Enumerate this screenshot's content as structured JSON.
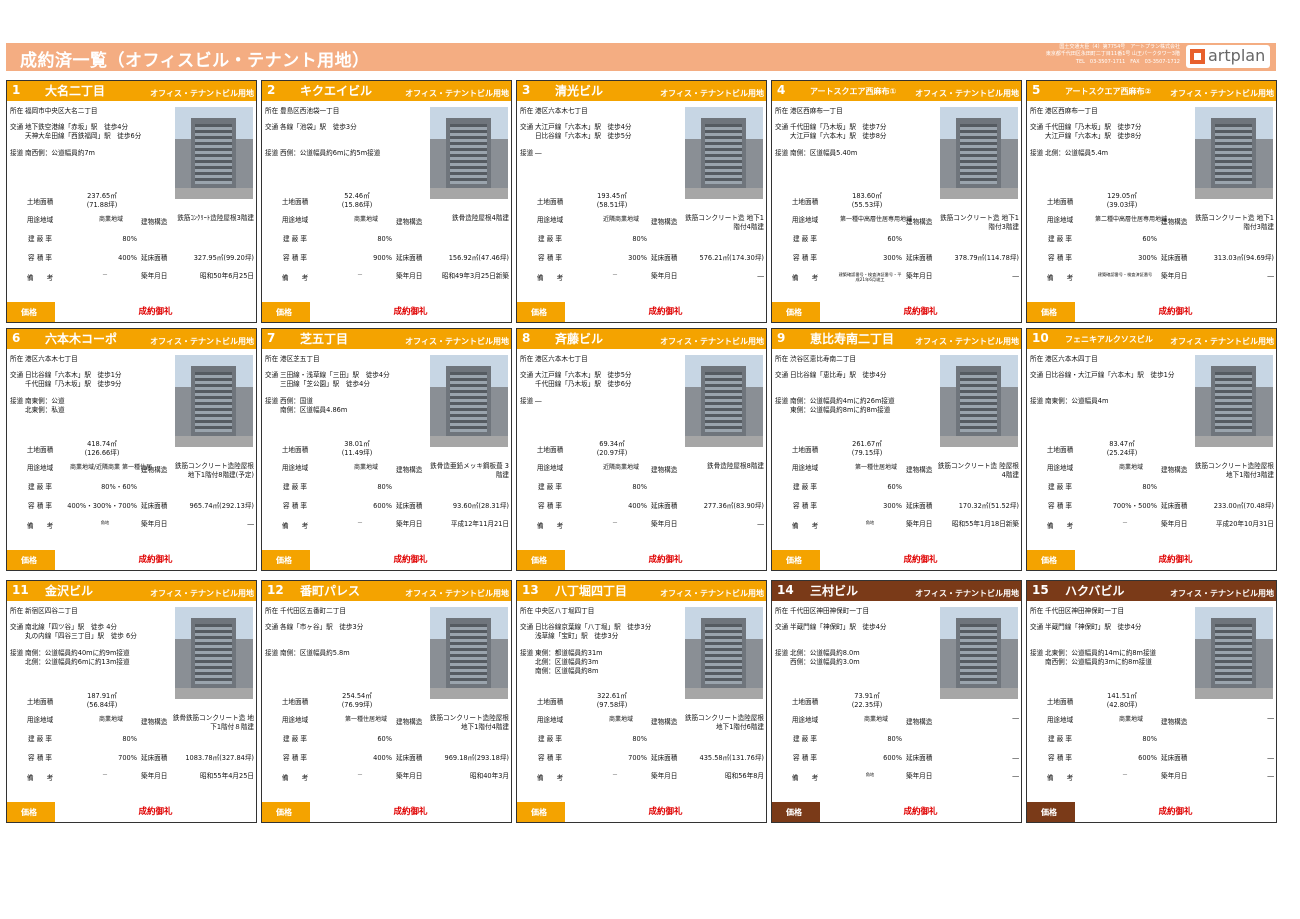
{
  "page": {
    "title": "成約済一覧（オフィスビル・テナント用地）",
    "company_lines": [
      "国土交通大臣（4）第7754号　アートプラン株式会社",
      "東京都千代田区永田町二丁目11番1号 山王パークタワー3階",
      "TEL　03-3507-1711　FAX　03-3507-1712"
    ],
    "logo_text": "artplan"
  },
  "labels": {
    "addr": "所在",
    "transit": "交通",
    "road": "接道",
    "land_area": "土地面積",
    "zoning": "用途地域",
    "coverage": "建 蔽 率",
    "far": "容 積 率",
    "remarks": "備　　考",
    "structure": "建物構造",
    "floor_area": "延床面積",
    "built": "築年月日",
    "price": "価格"
  },
  "properties": [
    {
      "num": "1",
      "name": "大名二丁目",
      "category": "オフィス・テナントビル用地",
      "address": "福岡市中央区大名二丁目",
      "transit": [
        "地下鉄空港線「赤坂」駅　徒歩4分",
        "天神大牟田線「西鉄福岡」駅　徒歩6分"
      ],
      "road": [
        "南西側：公道幅員約7m"
      ],
      "land_area": "237.65㎡",
      "land_tsubo": "(71.88坪)",
      "zoning": "商業地域",
      "coverage": "80%",
      "far": "400%",
      "remarks": "―",
      "structure": "鉄筋ｺﾝｸﾘｰﾄ造陸屋根3階建",
      "floor_area": "327.95㎡(99.20坪)",
      "built": "昭和50年6月25日",
      "price": "成約御礼"
    },
    {
      "num": "2",
      "name": "キクエイビル",
      "category": "オフィス・テナントビル用地",
      "address": "豊島区西池袋一丁目",
      "transit": [
        "各線「池袋」駅　徒歩3分"
      ],
      "road": [
        "西側：公道幅員約6mに約5m接道"
      ],
      "land_area": "52.46㎡",
      "land_tsubo": "(15.86坪)",
      "zoning": "商業地域",
      "coverage": "80%",
      "far": "900%",
      "remarks": "―",
      "structure": "鉄骨造陸屋根4階建",
      "floor_area": "156.92㎡(47.46坪)",
      "built": "昭和49年3月25日新築",
      "price": "成約御礼"
    },
    {
      "num": "3",
      "name": "清光ビル",
      "category": "オフィス・テナントビル用地",
      "address": "港区六本木七丁目",
      "transit": [
        "大江戸線「六本木」駅　徒歩4分",
        "日比谷線「六本木」駅　徒歩5分"
      ],
      "road": [
        "―"
      ],
      "land_area": "193.45㎡",
      "land_tsubo": "(58.51坪)",
      "zoning": "近隣商業地域",
      "coverage": "80%",
      "far": "300%",
      "remarks": "―",
      "structure": "鉄筋コンクリート造 地下1階付4階建",
      "floor_area": "576.21㎡(174.30坪)",
      "built": "―",
      "price": "成約御礼"
    },
    {
      "num": "4",
      "name": "アートスクエア西麻布①",
      "category": "オフィス・テナントビル用地",
      "address": "港区西麻布一丁目",
      "transit": [
        "千代田線「乃木坂」駅　徒歩7分",
        "大江戸線「六本木」駅　徒歩8分"
      ],
      "road": [
        "南側：区道幅員5.40m"
      ],
      "land_area": "183.60㎡",
      "land_tsubo": "(55.53坪)",
      "zoning": "第一種中高層住居専用地域",
      "coverage": "60%",
      "far": "300%",
      "remarks": "建築確認番号・検査済証番号・平成21年6月竣工",
      "structure": "鉄筋コンクリート造 地下1階付3階建",
      "floor_area": "378.79㎡(114.78坪)",
      "built": "―",
      "price": "成約御礼"
    },
    {
      "num": "5",
      "name": "アートスクエア西麻布②",
      "category": "オフィス・テナントビル用地",
      "address": "港区西麻布一丁目",
      "transit": [
        "千代田線「乃木坂」駅　徒歩7分",
        "大江戸線「六本木」駅　徒歩8分"
      ],
      "road": [
        "北側：公道幅員5.4m"
      ],
      "land_area": "129.05㎡",
      "land_tsubo": "(39.03坪)",
      "zoning": "第二種中高層住居専用地域",
      "coverage": "60%",
      "far": "300%",
      "remarks": "建築確認番号・検査済証番号",
      "structure": "鉄筋コンクリート造 地下1階付3階建",
      "floor_area": "313.03㎡(94.69坪)",
      "built": "―",
      "price": "成約御礼"
    },
    {
      "num": "6",
      "name": "六本木コーポ",
      "category": "オフィス・テナントビル用地",
      "address": "港区六本木七丁目",
      "transit": [
        "日比谷線「六本木」駅　徒歩1分",
        "千代田線「乃木坂」駅　徒歩9分"
      ],
      "road": [
        "南東側：公道",
        "北東側：私道"
      ],
      "land_area": "418.74㎡",
      "land_tsubo": "(126.66坪)",
      "zoning": "商業地域/近隣商業 第一種住居",
      "coverage": "80%・60%",
      "far": "400%・300%・700%",
      "remarks": "角地",
      "structure": "鉄筋コンクリート造陸屋根 地下1階付8階建(予定)",
      "floor_area": "965.74㎡(292.13坪)",
      "built": "―",
      "price": "成約御礼"
    },
    {
      "num": "7",
      "name": "芝五丁目",
      "category": "オフィス・テナントビル用地",
      "address": "港区芝五丁目",
      "transit": [
        "三田線・浅草線「三田」駅　徒歩4分",
        "三田線「芝公園」駅　徒歩4分"
      ],
      "road": [
        "西側：国道",
        "南側：区道幅員4.86m"
      ],
      "land_area": "38.01㎡",
      "land_tsubo": "(11.49坪)",
      "zoning": "商業地域",
      "coverage": "80%",
      "far": "600%",
      "remarks": "―",
      "structure": "鉄骨造亜鉛メッキ鋼板葺 3階建",
      "floor_area": "93.60㎡(28.31坪)",
      "built": "平成12年11月21日",
      "price": "成約御礼"
    },
    {
      "num": "8",
      "name": "斉藤ビル",
      "category": "オフィス・テナントビル用地",
      "address": "港区六本木七丁目",
      "transit": [
        "大江戸線「六本木」駅　徒歩5分",
        "千代田線「乃木坂」駅　徒歩6分"
      ],
      "road": [
        "―"
      ],
      "land_area": "69.34㎡",
      "land_tsubo": "(20.97坪)",
      "zoning": "近隣商業地域",
      "coverage": "80%",
      "far": "400%",
      "remarks": "―",
      "structure": "鉄骨造陸屋根8階建",
      "floor_area": "277.36㎡(83.90坪)",
      "built": "―",
      "price": "成約御礼"
    },
    {
      "num": "9",
      "name": "恵比寿南二丁目",
      "category": "オフィス・テナントビル用地",
      "address": "渋谷区恵比寿南二丁目",
      "transit": [
        "日比谷線「恵比寿」駅　徒歩4分"
      ],
      "road": [
        "南側：公道幅員約4mに約26m接道",
        "東側：公道幅員約8mに約8m接道"
      ],
      "land_area": "261.67㎡",
      "land_tsubo": "(79.15坪)",
      "zoning": "第一種住居地域",
      "coverage": "60%",
      "far": "300%",
      "remarks": "角地",
      "structure": "鉄筋コンクリート造 陸屋根4階建",
      "floor_area": "170.32㎡(51.52坪)",
      "built": "昭和55年1月18日新築",
      "price": "成約御礼"
    },
    {
      "num": "10",
      "name": "フェニキアルクソスビル",
      "category": "オフィス・テナントビル用地",
      "address": "港区六本木四丁目",
      "transit": [
        "日比谷線・大江戸線「六本木」駅　徒歩1分"
      ],
      "road": [
        "南東側：公道幅員4m"
      ],
      "land_area": "83.47㎡",
      "land_tsubo": "(25.24坪)",
      "zoning": "商業地域",
      "coverage": "80%",
      "far": "700%・500%",
      "remarks": "―",
      "structure": "鉄筋コンクリート造陸屋根 地下1階付3階建",
      "floor_area": "233.00㎡(70.48坪)",
      "built": "平成20年10月31日",
      "price": "成約御礼"
    },
    {
      "num": "11",
      "name": "金沢ビル",
      "category": "オフィス・テナントビル用地",
      "address": "新宿区四谷二丁目",
      "transit": [
        "南北線「四ツ谷」駅　徒歩 4分",
        "丸の内線「四谷三丁目」駅　徒歩 6分"
      ],
      "road": [
        "南側：公道幅員約40mに約9m接道",
        "北側：公道幅員約6mに約13m接道"
      ],
      "land_area": "187.91㎡",
      "land_tsubo": "(56.84坪)",
      "zoning": "商業地域",
      "coverage": "80%",
      "far": "700%",
      "remarks": "―",
      "structure": "鉄骨鉄筋コンクリート造 地下1階付８階建",
      "floor_area": "1083.78㎡(327.84坪)",
      "built": "昭和55年4月25日",
      "price": "成約御礼"
    },
    {
      "num": "12",
      "name": "番町パレス",
      "category": "オフィス・テナントビル用地",
      "address": "千代田区五番町二丁目",
      "transit": [
        "各線「市ヶ谷」駅　徒歩3分"
      ],
      "road": [
        "南側：区道幅員約5.8m"
      ],
      "land_area": "254.54㎡",
      "land_tsubo": "(76.99坪)",
      "zoning": "第一種住居地域",
      "coverage": "60%",
      "far": "400%",
      "remarks": "―",
      "structure": "鉄筋コンクリート造陸屋根 地下1階付4階建",
      "floor_area": "969.18㎡(293.18坪)",
      "built": "昭和40年3月",
      "price": "成約御礼"
    },
    {
      "num": "13",
      "name": "八丁堀四丁目",
      "category": "オフィス・テナントビル用地",
      "address": "中央区八丁堀四丁目",
      "transit": [
        "日比谷線京葉線「八丁堀」駅　徒歩3分",
        "浅草線「宝町」駅　徒歩3分"
      ],
      "road": [
        "東側：都道幅員約31m",
        "北側：区道幅員約3m",
        "南側：区道幅員約8m"
      ],
      "land_area": "322.61㎡",
      "land_tsubo": "(97.58坪)",
      "zoning": "商業地域",
      "coverage": "80%",
      "far": "700%",
      "remarks": "―",
      "structure": "鉄筋コンクリート造陸屋根 地下1階付6階建",
      "floor_area": "435.58㎡(131.76坪)",
      "built": "昭和56年8月",
      "price": "成約御礼"
    },
    {
      "num": "14",
      "name": "三村ビル",
      "category": "オフィス・テナントビル用地",
      "address": "千代田区神田神保町一丁目",
      "transit": [
        "半蔵門線「神保町」駅　徒歩4分"
      ],
      "road": [
        "北側：公道幅員約8.0m",
        "西側：公道幅員約3.0m"
      ],
      "land_area": "73.91㎡",
      "land_tsubo": "(22.35坪)",
      "zoning": "商業地域",
      "coverage": "80%",
      "far": "600%",
      "remarks": "角地",
      "structure": "―",
      "floor_area": "―",
      "built": "―",
      "price": "成約御礼"
    },
    {
      "num": "15",
      "name": "ハクバビル",
      "category": "オフィス・テナントビル用地",
      "address": "千代田区神田神保町一丁目",
      "transit": [
        "半蔵門線「神保町」駅　徒歩4分"
      ],
      "road": [
        "北東側：公道幅員約14mに約8m接道",
        "南西側：公道幅員約3mに約8m接道"
      ],
      "land_area": "141.51㎡",
      "land_tsubo": "(42.80坪)",
      "zoning": "商業地域",
      "coverage": "80%",
      "far": "600%",
      "remarks": "―",
      "structure": "―",
      "floor_area": "―",
      "built": "―",
      "price": "成約御礼"
    }
  ]
}
